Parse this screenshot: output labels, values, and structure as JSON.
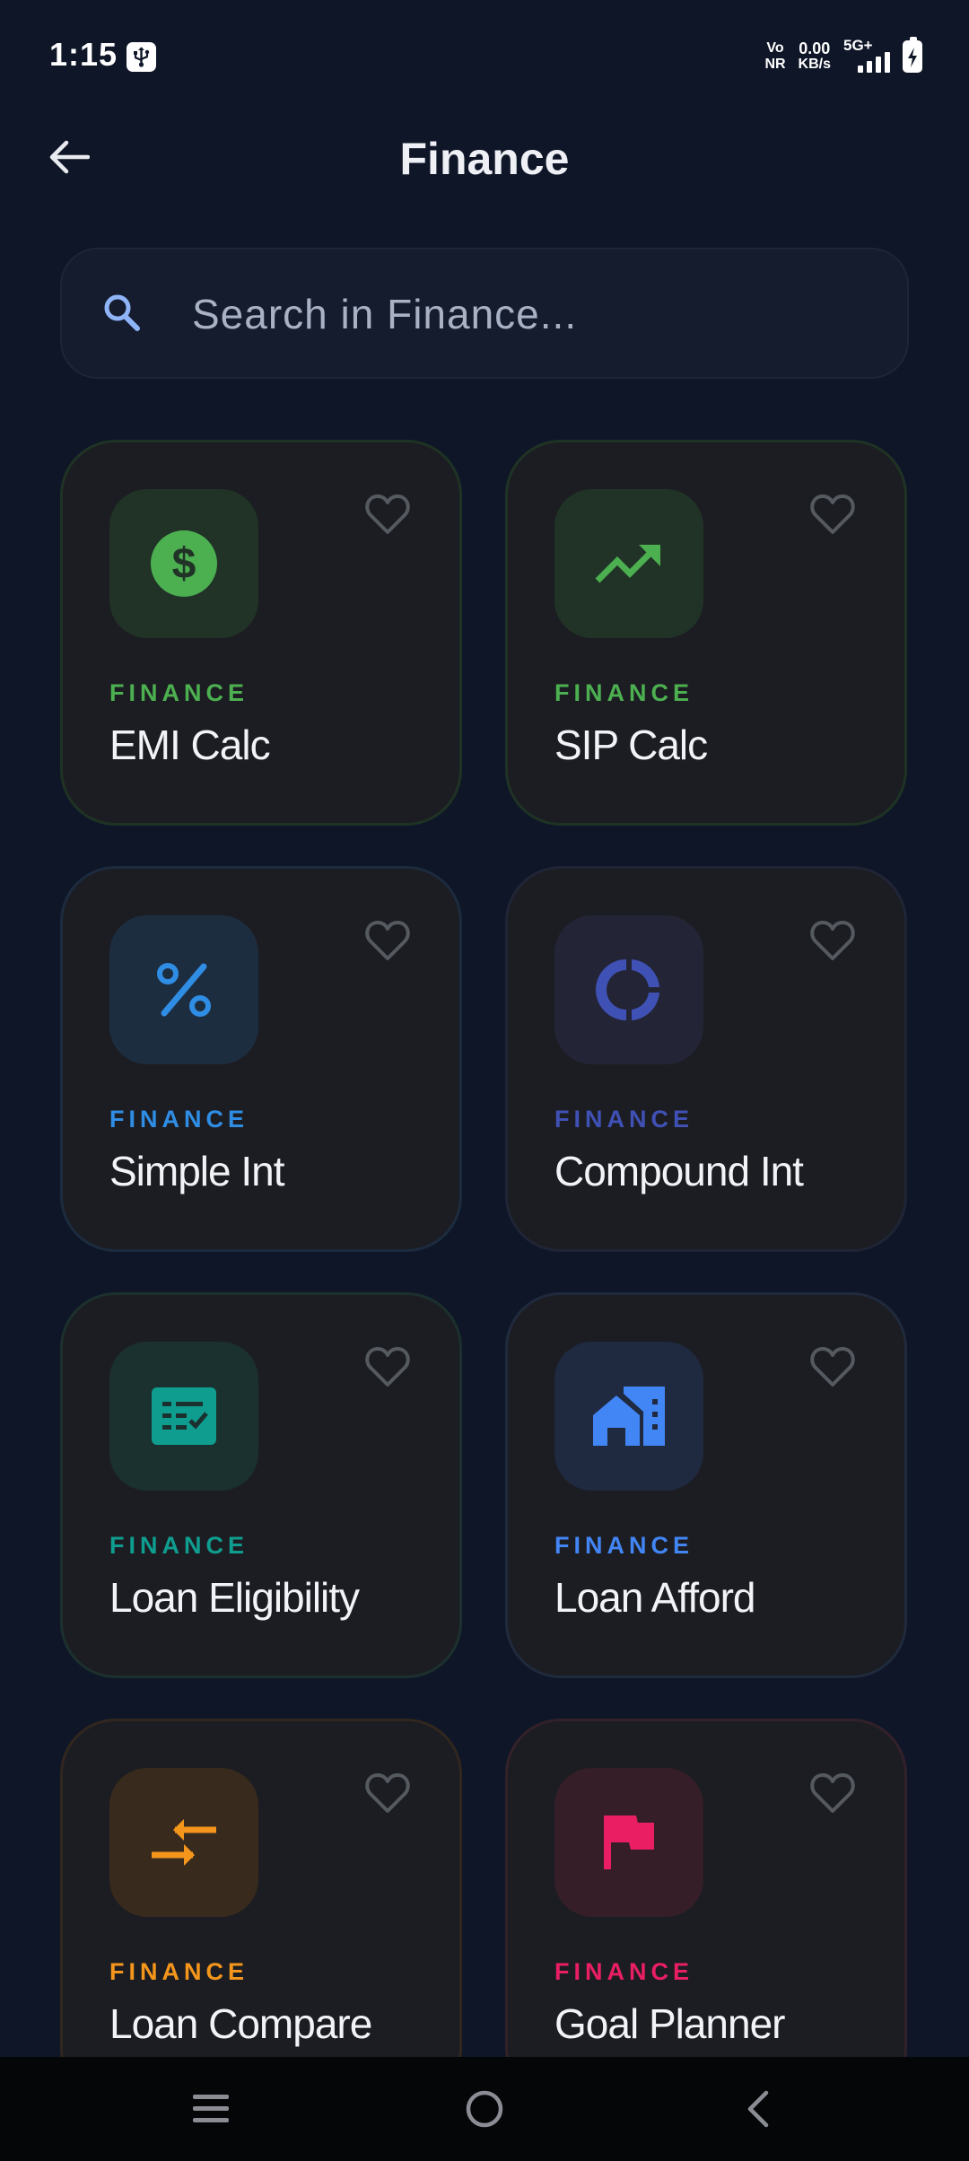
{
  "status_bar": {
    "time": "1:15",
    "volte_top": "Vo",
    "volte_bottom": "NR",
    "speed_value": "0.00",
    "speed_unit": "KB/s",
    "network": "5G+",
    "icons": [
      "usb-icon",
      "signal-icon",
      "battery-charging-icon"
    ]
  },
  "header": {
    "title": "Finance",
    "back_icon": "arrow-left-icon"
  },
  "search": {
    "placeholder": "Search in Finance...",
    "value": "",
    "icon": "search-icon"
  },
  "cards": [
    {
      "category": "FINANCE",
      "name": "EMI Calc",
      "icon": "dollar-icon",
      "accent": "#4caf50",
      "tile_bg": "#213327",
      "border": "#1f3325"
    },
    {
      "category": "FINANCE",
      "name": "SIP Calc",
      "icon": "trending-up-icon",
      "accent": "#4caf50",
      "tile_bg": "#213327",
      "border": "#1f3325"
    },
    {
      "category": "FINANCE",
      "name": "Simple Int",
      "icon": "percent-icon",
      "accent": "#2f8de4",
      "tile_bg": "#1d2d40",
      "border": "#1c2b3e"
    },
    {
      "category": "FINANCE",
      "name": "Compound Int",
      "icon": "donut-chart-icon",
      "accent": "#3f51b5",
      "tile_bg": "#232536",
      "border": "#202536"
    },
    {
      "category": "FINANCE",
      "name": "Loan Eligibility",
      "icon": "checklist-icon",
      "accent": "#0f9d8f",
      "tile_bg": "#1b312f",
      "border": "#1c302e"
    },
    {
      "category": "FINANCE",
      "name": "Loan Afford",
      "icon": "house-icon",
      "accent": "#4285f4",
      "tile_bg": "#1f2a40",
      "border": "#1f2a3c"
    },
    {
      "category": "FINANCE",
      "name": "Loan Compare",
      "icon": "compare-arrows-icon",
      "accent": "#f4951c",
      "tile_bg": "#382a1d",
      "border": "#31271f"
    },
    {
      "category": "FINANCE",
      "name": "Goal Planner",
      "icon": "flag-icon",
      "accent": "#e91e63",
      "tile_bg": "#351e28",
      "border": "#33212a"
    }
  ],
  "favorite_icon": "heart-outline-icon",
  "nav_bar": {
    "items": [
      "menu-icon",
      "home-icon",
      "back-icon"
    ]
  }
}
